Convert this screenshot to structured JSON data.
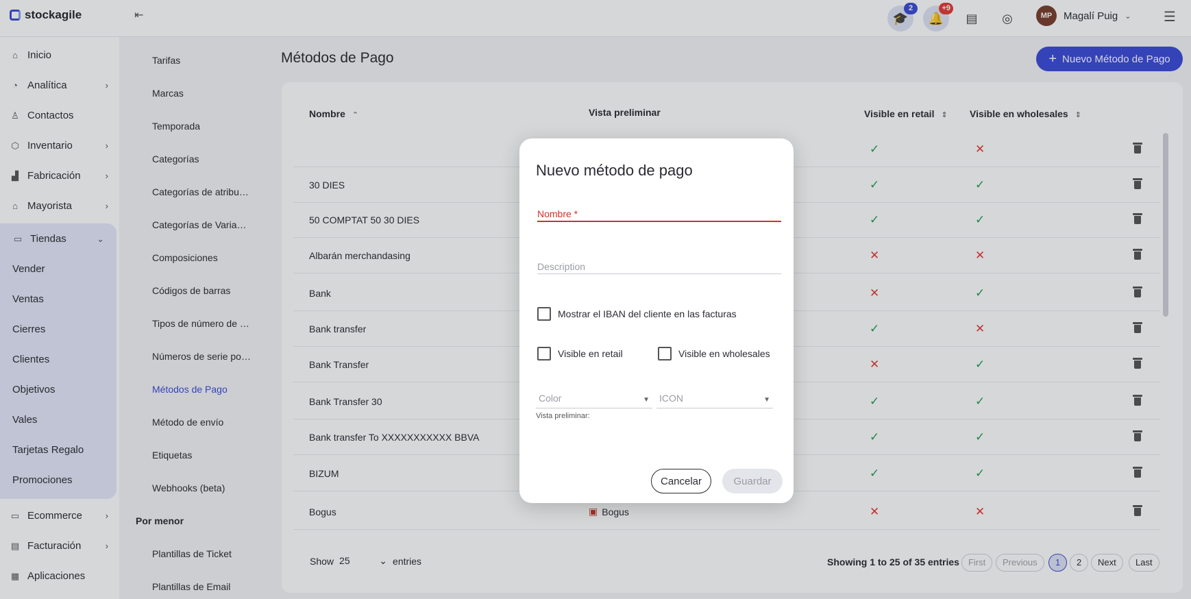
{
  "brand": "stockagile",
  "topbar": {
    "courses_badge": "2",
    "notifications_badge": "+9",
    "user_initials": "MP",
    "user_name": "Magalí Puig"
  },
  "sidebar": {
    "items": [
      {
        "label": "Inicio",
        "icon": "home-icon"
      },
      {
        "label": "Analítica",
        "icon": "analytics-icon"
      },
      {
        "label": "Contactos",
        "icon": "contacts-icon"
      },
      {
        "label": "Inventario",
        "icon": "inventory-icon"
      },
      {
        "label": "Fabricación",
        "icon": "factory-icon"
      },
      {
        "label": "Mayorista",
        "icon": "wholesale-icon"
      },
      {
        "label": "Tiendas",
        "icon": "store-icon"
      },
      {
        "label": "Ecommerce",
        "icon": "laptop-icon"
      },
      {
        "label": "Facturación",
        "icon": "invoice-icon"
      },
      {
        "label": "Aplicaciones",
        "icon": "apps-icon"
      }
    ],
    "tiendas_sub": [
      "Vender",
      "Ventas",
      "Cierres",
      "Clientes",
      "Objetivos",
      "Vales",
      "Tarjetas Regalo",
      "Promociones"
    ]
  },
  "subnav": {
    "items": [
      "Tarifas",
      "Marcas",
      "Temporada",
      "Categorías",
      "Categorías de atribu…",
      "Categorías de Varia…",
      "Composiciones",
      "Códigos de barras",
      "Tipos de número de …",
      "Números de serie po…",
      "Métodos de Pago",
      "Método de envío",
      "Etiquetas",
      "Webhooks (beta)"
    ],
    "section_header": "Por menor",
    "section_items": [
      "Plantillas de Ticket",
      "Plantillas de Email"
    ]
  },
  "main": {
    "title": "Métodos de Pago",
    "new_button": "Nuevo Método de Pago",
    "columns": {
      "name": "Nombre",
      "preview": "Vista preliminar",
      "retail": "Visible en retail",
      "wholesale": "Visible en wholesales"
    },
    "rows": [
      {
        "name": "",
        "preview": "",
        "retail": true,
        "wholesale": false
      },
      {
        "name": "30 DIES",
        "preview": "",
        "retail": true,
        "wholesale": true
      },
      {
        "name": "50 COMPTAT 50 30 DIES",
        "preview": "",
        "retail": true,
        "wholesale": true
      },
      {
        "name": "Albarán merchandasing",
        "preview": "",
        "retail": false,
        "wholesale": false
      },
      {
        "name": "Bank",
        "preview": "",
        "retail": false,
        "wholesale": true
      },
      {
        "name": "Bank transfer",
        "preview": "",
        "retail": true,
        "wholesale": false
      },
      {
        "name": "Bank Transfer",
        "preview": "",
        "retail": false,
        "wholesale": true
      },
      {
        "name": "Bank Transfer 30",
        "preview": "",
        "retail": true,
        "wholesale": true
      },
      {
        "name": "Bank transfer To XXXXXXXXXXX BBVA",
        "preview": "",
        "retail": true,
        "wholesale": true
      },
      {
        "name": "BIZUM",
        "preview": "",
        "retail": true,
        "wholesale": true
      },
      {
        "name": "Bogus",
        "preview": "Bogus",
        "retail": false,
        "wholesale": false
      }
    ],
    "show_label": "Show",
    "show_value": "25",
    "entries_label": "entries",
    "info": "Showing 1 to 25 of 35 entries",
    "pagination": [
      "First",
      "Previous",
      "1",
      "2",
      "Next",
      "Last"
    ]
  },
  "modal": {
    "title": "Nuevo método de pago",
    "name_placeholder": "Nombre *",
    "description_placeholder": "Description",
    "show_iban_label": "Mostrar el IBAN del cliente en las facturas",
    "visible_retail_label": "Visible en retail",
    "visible_wholesale_label": "Visible en wholesales",
    "color_placeholder": "Color",
    "icon_placeholder": "ICON",
    "preview_label": "Vista preliminar:",
    "cancel": "Cancelar",
    "save": "Guardar"
  },
  "colors": {
    "accent": "#3b4bd8",
    "ok": "#1f9d55",
    "error": "#e53935"
  }
}
